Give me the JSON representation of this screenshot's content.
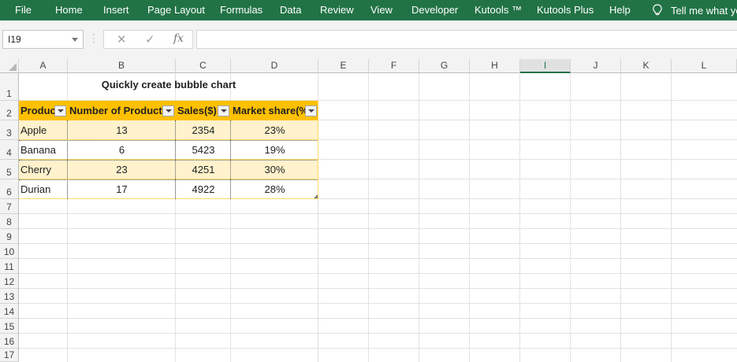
{
  "ribbon": {
    "tabs": [
      "File",
      "Home",
      "Insert",
      "Page Layout",
      "Formulas",
      "Data",
      "Review",
      "View",
      "Developer",
      "Kutools ™",
      "Kutools Plus",
      "Help"
    ],
    "tell_me": "Tell me what yo"
  },
  "formula_bar": {
    "name_box": "I19",
    "cancel_glyph": "✕",
    "enter_glyph": "✓",
    "fx_label": "fx",
    "formula": ""
  },
  "columns": [
    "A",
    "B",
    "C",
    "D",
    "E",
    "F",
    "G",
    "H",
    "I",
    "J",
    "K",
    "L"
  ],
  "active_column": "I",
  "rows": [
    "1",
    "2",
    "3",
    "4",
    "5",
    "6",
    "7",
    "8",
    "9",
    "10",
    "11",
    "12",
    "13",
    "14",
    "15",
    "16",
    "17"
  ],
  "sheet": {
    "title": "Quickly create bubble chart",
    "headers": [
      "Produc",
      "Number of Product",
      "Sales($)",
      "Market share(%"
    ],
    "data": [
      [
        "Apple",
        "13",
        "2354",
        "23%"
      ],
      [
        "Banana",
        "6",
        "5423",
        "19%"
      ],
      [
        "Cherry",
        "23",
        "4251",
        "30%"
      ],
      [
        "Durian",
        "17",
        "4922",
        "28%"
      ]
    ]
  },
  "colors": {
    "ribbon": "#217346",
    "table_header": "#ffc000",
    "table_band": "#fff2cc"
  }
}
